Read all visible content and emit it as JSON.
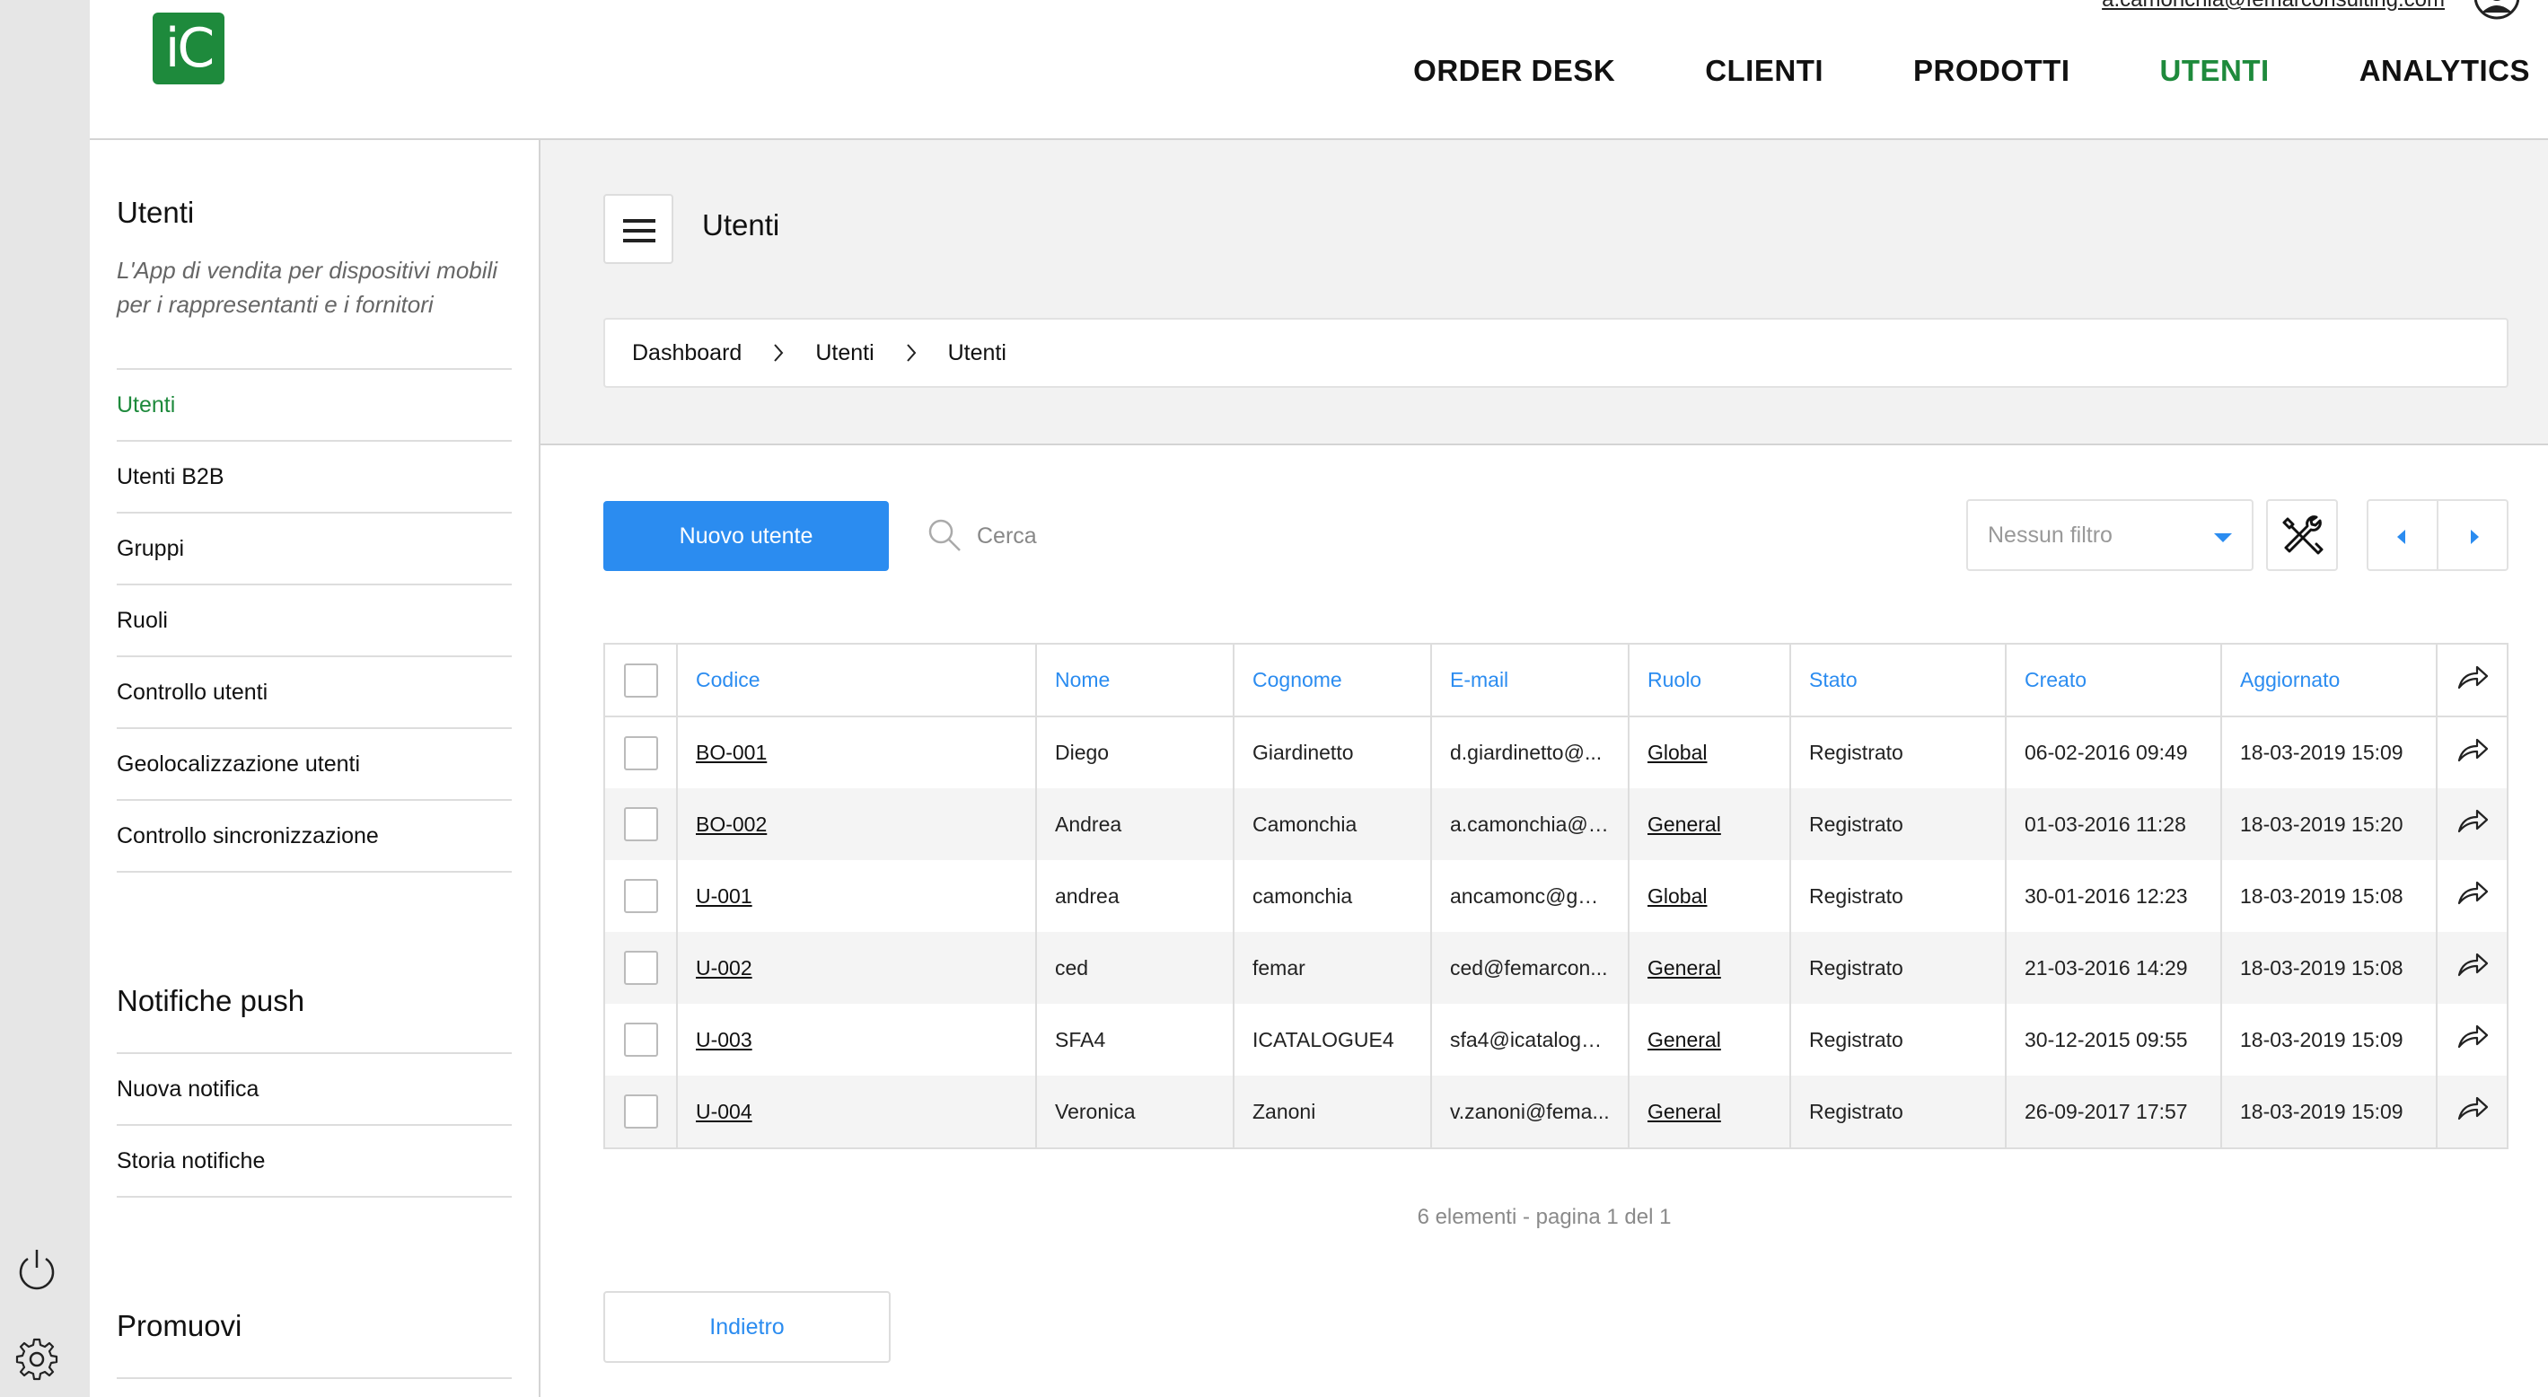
{
  "header": {
    "logo_text": "iC",
    "user_email": "a.camonchia@femarconsulting.com",
    "nav": [
      "ORDER DESK",
      "CLIENTI",
      "PRODOTTI",
      "UTENTI",
      "ANALYTICS"
    ],
    "active_nav": "UTENTI"
  },
  "sidebar": {
    "section1_title": "Utenti",
    "description": "L'App di vendita per dispositivi mobili per i rappresentanti e i fornitori",
    "items": [
      "Utenti",
      "Utenti B2B",
      "Gruppi",
      "Ruoli",
      "Controllo utenti",
      "Geolocalizzazione utenti",
      "Controllo sincronizzazione"
    ],
    "active_item": "Utenti",
    "section2_title": "Notifiche push",
    "push_items": [
      "Nuova notifica",
      "Storia notifiche"
    ],
    "section3_title": "Promuovi"
  },
  "main": {
    "title": "Utenti",
    "breadcrumb": [
      "Dashboard",
      "Utenti",
      "Utenti"
    ],
    "new_user_label": "Nuovo utente",
    "search_placeholder": "Cerca",
    "filter_label": "Nessun filtro",
    "back_label": "Indietro",
    "count_text": "6 elementi - pagina 1 del 1"
  },
  "table": {
    "columns": [
      "Codice",
      "Nome",
      "Cognome",
      "E-mail",
      "Ruolo",
      "Stato",
      "Creato",
      "Aggiornato"
    ],
    "rows": [
      {
        "codice": "BO-001",
        "nome": "Diego",
        "cognome": "Giardinetto",
        "email": "d.giardinetto@...",
        "ruolo": "Global",
        "stato": "Registrato",
        "creato": "06-02-2016 09:49",
        "aggiornato": "18-03-2019 15:09"
      },
      {
        "codice": "BO-002",
        "nome": "Andrea",
        "cognome": "Camonchia",
        "email": "a.camonchia@f...",
        "ruolo": "General",
        "stato": "Registrato",
        "creato": "01-03-2016 11:28",
        "aggiornato": "18-03-2019 15:20"
      },
      {
        "codice": "U-001",
        "nome": "andrea",
        "cognome": "camonchia",
        "email": "ancamonc@gm...",
        "ruolo": "Global",
        "stato": "Registrato",
        "creato": "30-01-2016 12:23",
        "aggiornato": "18-03-2019 15:08"
      },
      {
        "codice": "U-002",
        "nome": "ced",
        "cognome": "femar",
        "email": "ced@femarcon...",
        "ruolo": "General",
        "stato": "Registrato",
        "creato": "21-03-2016 14:29",
        "aggiornato": "18-03-2019 15:08"
      },
      {
        "codice": "U-003",
        "nome": "SFA4",
        "cognome": "ICATALOGUE4",
        "email": "sfa4@icatalogu...",
        "ruolo": "General",
        "stato": "Registrato",
        "creato": "30-12-2015 09:55",
        "aggiornato": "18-03-2019 15:09"
      },
      {
        "codice": "U-004",
        "nome": "Veronica",
        "cognome": "Zanoni",
        "email": "v.zanoni@fema...",
        "ruolo": "General",
        "stato": "Registrato",
        "creato": "26-09-2017 17:57",
        "aggiornato": "18-03-2019 15:09"
      }
    ]
  },
  "icons": {
    "power": "power-icon",
    "settings": "gear-icon",
    "menu": "hamburger-icon",
    "search": "search-icon",
    "tools": "tools-icon",
    "share": "share-icon"
  },
  "colors": {
    "brand_green": "#1e8a3c",
    "accent_blue": "#2b8cf0"
  }
}
